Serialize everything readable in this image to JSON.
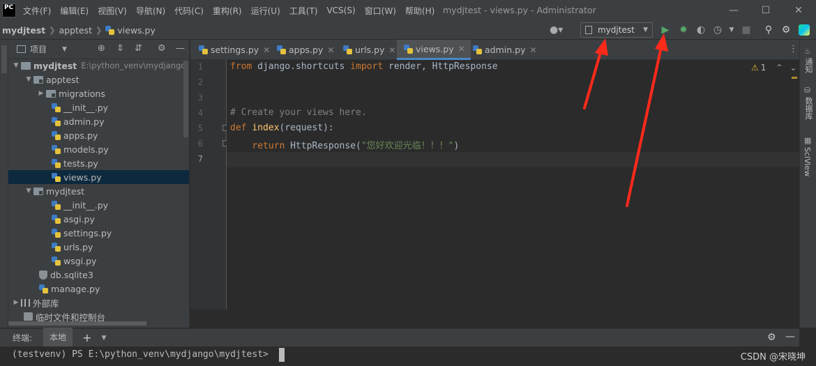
{
  "menubar": {
    "logo": "PC",
    "items": [
      "文件(F)",
      "编辑(E)",
      "视图(V)",
      "导航(N)",
      "代码(C)",
      "重构(R)",
      "运行(U)",
      "工具(T)",
      "VCS(S)",
      "窗口(W)",
      "帮助(H)"
    ],
    "window_title": "mydjtest - views.py - Administrator"
  },
  "navbar": {
    "breadcrumbs": [
      "mydjtest",
      "apptest",
      "views.py"
    ],
    "run_config": "mydjtest"
  },
  "project_panel": {
    "title": "项目",
    "tree": [
      {
        "label": "mydjtest",
        "path": "E:\\python_venv\\mydjango\\"
      },
      {
        "label": "apptest"
      },
      {
        "label": "migrations"
      },
      {
        "label": "__init__.py"
      },
      {
        "label": "admin.py"
      },
      {
        "label": "apps.py"
      },
      {
        "label": "models.py"
      },
      {
        "label": "tests.py"
      },
      {
        "label": "views.py"
      },
      {
        "label": "mydjtest"
      },
      {
        "label": "__init__.py"
      },
      {
        "label": "asgi.py"
      },
      {
        "label": "settings.py"
      },
      {
        "label": "urls.py"
      },
      {
        "label": "wsgi.py"
      },
      {
        "label": "db.sqlite3"
      },
      {
        "label": "manage.py"
      },
      {
        "label": "外部库"
      },
      {
        "label": "临时文件和控制台"
      }
    ]
  },
  "tabs": [
    {
      "label": "settings.py"
    },
    {
      "label": "apps.py"
    },
    {
      "label": "urls.py"
    },
    {
      "label": "views.py"
    },
    {
      "label": "admin.py"
    }
  ],
  "editor": {
    "line_numbers": [
      "1",
      "2",
      "3",
      "4",
      "5",
      "6",
      "7"
    ],
    "tokens": {
      "from": "from",
      "module": " django.shortcuts ",
      "import": "import",
      "names": " render, HttpResponse",
      "comment": "# Create your views here.",
      "def": "def",
      "fn_name": "index",
      "params": "(request):",
      "return": "return",
      "call": " HttpResponse(",
      "string": "\"您好欢迎光临！！！\"",
      "close": ")"
    },
    "warning_count": "1"
  },
  "right_stripe": {
    "labels": [
      "通知",
      "数据库",
      "SciView"
    ]
  },
  "terminal": {
    "title": "终端:",
    "tab": "本地",
    "prompt": "(testvenv) PS E:\\python_venv\\mydjango\\mydjtest>",
    "watermark": "CSDN @宋晓坤"
  },
  "colors": {
    "accent": "#4a88c7",
    "run": "#59a869",
    "annotation_arrow": "#ff2a1a"
  }
}
